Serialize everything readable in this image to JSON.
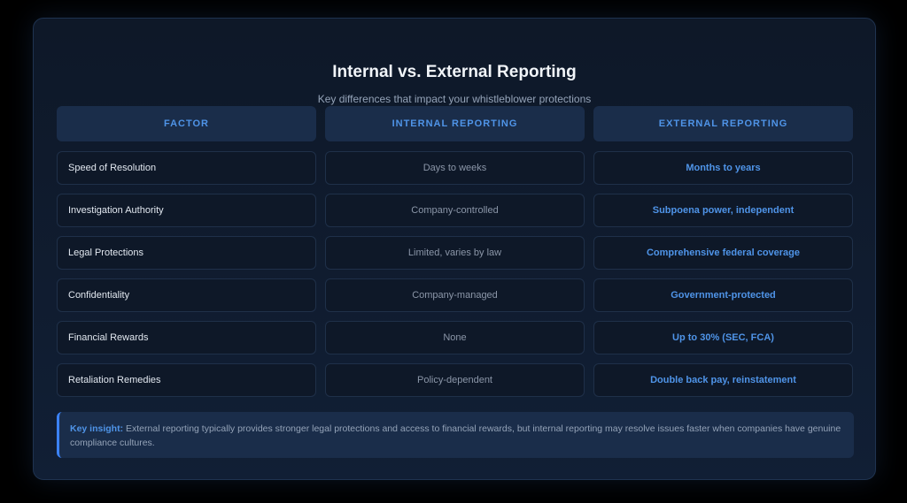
{
  "title": "Internal vs. External Reporting",
  "subtitle": "Key differences that impact your whistleblower protections",
  "headers": [
    "FACTOR",
    "INTERNAL REPORTING",
    "EXTERNAL REPORTING"
  ],
  "rows": [
    {
      "factor": "Speed of Resolution",
      "internal": "Days to weeks",
      "external": "Months to years"
    },
    {
      "factor": "Investigation Authority",
      "internal": "Company-controlled",
      "external": "Subpoena power, independent"
    },
    {
      "factor": "Legal Protections",
      "internal": "Limited, varies by law",
      "external": "Comprehensive federal coverage"
    },
    {
      "factor": "Confidentiality",
      "internal": "Company-managed",
      "external": "Government-protected"
    },
    {
      "factor": "Financial Rewards",
      "internal": "None",
      "external": "Up to 30% (SEC, FCA)"
    },
    {
      "factor": "Retaliation Remedies",
      "internal": "Policy-dependent",
      "external": "Double back pay, reinstatement"
    }
  ],
  "insight": {
    "label": "Key insight:",
    "text": " External reporting typically provides stronger legal protections and access to financial rewards, but internal reporting may resolve issues faster when companies have genuine compliance cultures."
  }
}
